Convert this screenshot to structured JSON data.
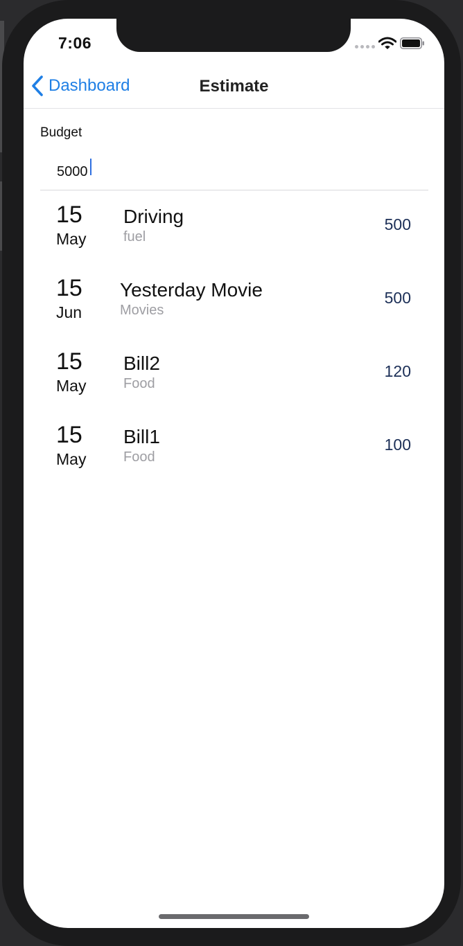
{
  "status_bar": {
    "time": "7:06"
  },
  "nav": {
    "back_label": "Dashboard",
    "title": "Estimate"
  },
  "budget": {
    "label": "Budget",
    "value": "5000"
  },
  "entries": [
    {
      "day": "15",
      "month": "May",
      "name": "Driving",
      "category": "fuel",
      "amount": "500"
    },
    {
      "day": "15",
      "month": "Jun",
      "name": "Yesterday Movie",
      "category": "Movies",
      "amount": "500"
    },
    {
      "day": "15",
      "month": "May",
      "name": "Bill2",
      "category": "Food",
      "amount": "120"
    },
    {
      "day": "15",
      "month": "May",
      "name": "Bill1",
      "category": "Food",
      "amount": "100"
    }
  ],
  "colors": {
    "accent": "#1f7fe5",
    "amount": "#1c2f57",
    "subtitle": "#9e9ea3"
  },
  "icons": [
    "chevron-left-icon",
    "cellular-signal-icon",
    "wifi-icon",
    "battery-icon"
  ]
}
